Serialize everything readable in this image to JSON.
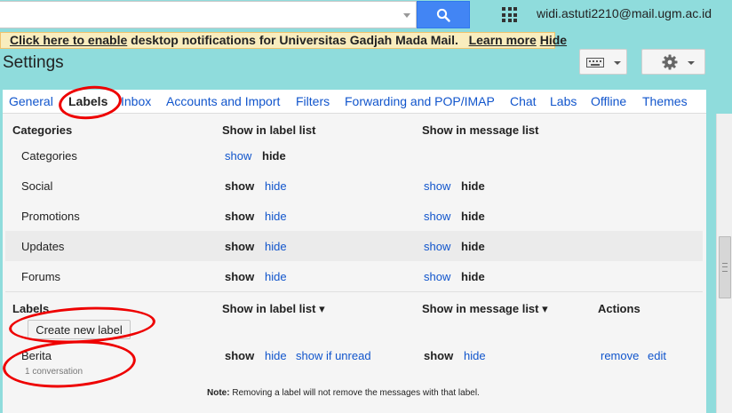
{
  "search": {
    "placeholder": "",
    "value": ""
  },
  "header": {
    "account": "widi.astuti2210@mail.ugm.ac.id"
  },
  "notification": {
    "link": "Click here to enable",
    "text": " desktop notifications for Universitas Gadjah Mada Mail.",
    "learn_more": "Learn more",
    "hide": "Hide"
  },
  "page": {
    "title": "Settings"
  },
  "tabs": [
    {
      "label": "General"
    },
    {
      "label": "Labels"
    },
    {
      "label": "Inbox"
    },
    {
      "label": "Accounts and Import"
    },
    {
      "label": "Filters"
    },
    {
      "label": "Forwarding and POP/IMAP"
    },
    {
      "label": "Chat"
    },
    {
      "label": "Labs"
    },
    {
      "label": "Offline"
    },
    {
      "label": "Themes"
    }
  ],
  "categories": {
    "header": "Categories",
    "col_label_list": "Show in label list",
    "col_message_list": "Show in message list",
    "rows": [
      {
        "name": "Categories",
        "label_show": "show",
        "label_hide": "hide"
      },
      {
        "name": "Social",
        "label_show": "show",
        "label_hide": "hide",
        "msg_show": "show",
        "msg_hide": "hide"
      },
      {
        "name": "Promotions",
        "label_show": "show",
        "label_hide": "hide",
        "msg_show": "show",
        "msg_hide": "hide"
      },
      {
        "name": "Updates",
        "label_show": "show",
        "label_hide": "hide",
        "msg_show": "show",
        "msg_hide": "hide"
      },
      {
        "name": "Forums",
        "label_show": "show",
        "label_hide": "hide",
        "msg_show": "show",
        "msg_hide": "hide"
      }
    ]
  },
  "labels": {
    "header": "Labels",
    "col_label_list": "Show in label list ▾",
    "col_message_list": "Show in message list ▾",
    "col_actions": "Actions",
    "create_button": "Create new label",
    "items": [
      {
        "name": "Berita",
        "sub": "1 conversation",
        "label_show": "show",
        "label_hide": "hide",
        "label_unread": "show if unread",
        "msg_show": "show",
        "msg_hide": "hide",
        "remove": "remove",
        "edit": "edit"
      }
    ],
    "note_prefix": "Note:",
    "note_text": " Removing a label will not remove the messages with that label."
  },
  "colors": {
    "background": "#8fdcdc",
    "link": "#1155cc",
    "search_button": "#4285f4",
    "annotation": "#e00000"
  }
}
